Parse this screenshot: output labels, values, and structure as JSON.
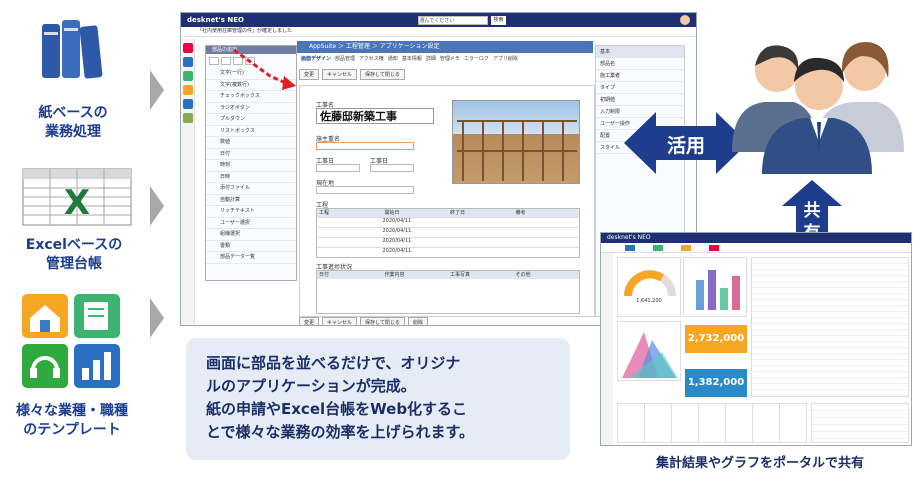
{
  "left_items": [
    {
      "label": "紙ベースの\n業務処理",
      "icon": "books-icon"
    },
    {
      "label": "Excelベースの\n管理台帳",
      "icon": "excel-sheet-icon"
    },
    {
      "label": "様々な業種・職種\nのテンプレート",
      "icon": "template-tiles-icon"
    }
  ],
  "app": {
    "brand": "desknet's NEO",
    "search_placeholder": "選んでください",
    "search_button": "検索",
    "breadcrumb": "AppSuite ＞ 工程管理 ＞ アプリケーション設定",
    "notice": "「社内使用在庫管理の件」が確定しました",
    "tabs": [
      "画面デザイン",
      "部品管理",
      "アクセス権",
      "通知",
      "基本情報",
      "詳細",
      "管理メモ",
      "エラーログ",
      "アプリ削除"
    ],
    "buttons": [
      "変更",
      "キャンセル",
      "保存して閉じる"
    ],
    "parts_title": "部品の追加",
    "parts": [
      "文字(一行)",
      "文字(複数行)",
      "チェックボックス",
      "ラジオボタン",
      "プルダウン",
      "リストボックス",
      "数値",
      "日付",
      "時刻",
      "日時",
      "添付ファイル",
      "自動計算",
      "リッチテキスト",
      "ユーザー選択",
      "組織選択",
      "書類",
      "部品データー覧"
    ],
    "form_title_label": "工事名",
    "form_title": "佐藤邸新築工事",
    "form_labels": [
      "施主重名",
      "工事日",
      "工事日",
      "現在地",
      "工程",
      "工事進捗状況"
    ],
    "table_headers": [
      "工程",
      "開始日",
      "終了日",
      "備考"
    ],
    "dates": [
      "2020/04/11",
      "2020/04/11",
      "2020/04/11",
      "2020/04/11"
    ],
    "table2_headers": [
      "日付",
      "作業内容",
      "工事写真",
      "その他"
    ],
    "right_panel": [
      "基本",
      "部品名",
      "施工業者",
      "タイプ",
      "初期値",
      "入力制限",
      "ユーザー操作",
      "配置",
      "スタイル"
    ],
    "footer_buttons": [
      "変更",
      "キャンセル",
      "保存して閉じる",
      "削除"
    ]
  },
  "callout": "画面に部品を並べるだけで、オリジナ\nルのアプリケーションが完成。\n紙の申請やExcel台帳をWeb化するこ\nとで様々な業務の効率を上げられます。",
  "arrow_use": "活用",
  "arrow_share": "共\n有",
  "portal": {
    "brand": "desknet's NEO",
    "values": [
      "1,641,200",
      "2,732,000",
      "1,382,000"
    ],
    "caption": "集計結果やグラフをポータルで共有"
  },
  "colors": {
    "navy": "#1e2f73",
    "label": "#1c3d8f",
    "callout_bg": "#e6ecf6",
    "arrow": "#1e3d8c",
    "chevron": "#a8a8a8",
    "green": "#6a9e3a"
  }
}
